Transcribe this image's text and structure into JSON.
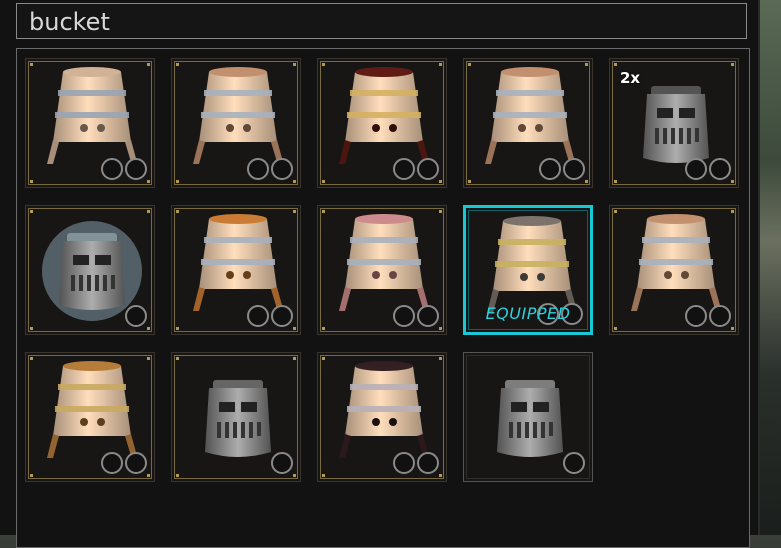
{
  "search": {
    "value": "bucket"
  },
  "colors": {
    "equipped_border": "#18c8d4",
    "slot_border": "#7a6a40"
  },
  "items": [
    {
      "kind": "bucket",
      "body": "#e8c6a8",
      "band": "#9aa4b2",
      "circles": 2,
      "count": "",
      "label": "",
      "equipped": false,
      "plain": false
    },
    {
      "kind": "bucket",
      "body": "#d7a07a",
      "band": "#a8b0bc",
      "circles": 2,
      "count": "",
      "label": "",
      "equipped": false,
      "plain": false
    },
    {
      "kind": "bucket",
      "body": "#6a1e16",
      "band": "#d4b060",
      "circles": 2,
      "count": "",
      "label": "",
      "equipped": false,
      "plain": false
    },
    {
      "kind": "bucket",
      "body": "#d7a07a",
      "band": "#a8b0bc",
      "circles": 2,
      "count": "",
      "label": "",
      "equipped": false,
      "plain": false
    },
    {
      "kind": "helm",
      "body": "#8a8a8a",
      "band": "#ffffff",
      "circles": 2,
      "count": "2x",
      "label": "",
      "equipped": false,
      "plain": false
    },
    {
      "kind": "helm",
      "body": "#d8f4ff",
      "band": "#ffffff",
      "circles": 1,
      "count": "",
      "label": "",
      "equipped": false,
      "plain": false,
      "glow": true
    },
    {
      "kind": "bucket",
      "body": "#e08a3a",
      "band": "#a8b0bc",
      "circles": 2,
      "count": "",
      "label": "",
      "equipped": false,
      "plain": false
    },
    {
      "kind": "bucket",
      "body": "#e49a9a",
      "band": "#a8b0bc",
      "circles": 2,
      "count": "",
      "label": "",
      "equipped": false,
      "plain": false
    },
    {
      "kind": "bucket",
      "body": "#8a8078",
      "band": "#c8b060",
      "circles": 2,
      "count": "",
      "label": "EQUIPPED",
      "equipped": true,
      "plain": false
    },
    {
      "kind": "bucket",
      "body": "#d7a07a",
      "band": "#a8b0bc",
      "circles": 2,
      "count": "",
      "label": "",
      "equipped": false,
      "plain": false
    },
    {
      "kind": "bucket",
      "body": "#c98a40",
      "band": "#c8a860",
      "circles": 2,
      "count": "",
      "label": "",
      "equipped": false,
      "plain": false
    },
    {
      "kind": "helm",
      "body": "#a8a8a8",
      "band": "#ffffff",
      "circles": 1,
      "count": "",
      "label": "",
      "equipped": false,
      "plain": false
    },
    {
      "kind": "bucket",
      "body": "#3a2226",
      "band": "#b8b0b8",
      "circles": 2,
      "count": "",
      "label": "",
      "equipped": false,
      "plain": false
    },
    {
      "kind": "helm",
      "body": "#d0d0d0",
      "band": "#ffffff",
      "circles": 1,
      "count": "",
      "label": "",
      "equipped": false,
      "plain": true
    }
  ]
}
